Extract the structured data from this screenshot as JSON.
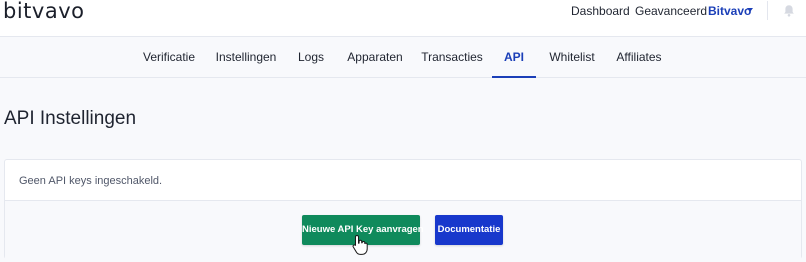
{
  "app": {
    "logo_text": "bitvavo"
  },
  "topnav": {
    "dashboard": "Dashboard",
    "advanced": "Geavanceerd",
    "account": "Bitvavo"
  },
  "tabs": [
    {
      "label": "Verificatie"
    },
    {
      "label": "Instellingen"
    },
    {
      "label": "Logs"
    },
    {
      "label": "Apparaten"
    },
    {
      "label": "Transacties"
    },
    {
      "label": "API"
    },
    {
      "label": "Whitelist"
    },
    {
      "label": "Affiliates"
    }
  ],
  "active_tab": "API",
  "page": {
    "title": "API Instellingen"
  },
  "card": {
    "message": "Geen API keys ingeschakeld.",
    "request_button": "Nieuwe API Key aanvragen",
    "docs_button": "Documentatie"
  },
  "colors": {
    "accent": "#1b3fb8",
    "primary_button": "#0f8a5c",
    "secondary_button": "#1838cc"
  }
}
